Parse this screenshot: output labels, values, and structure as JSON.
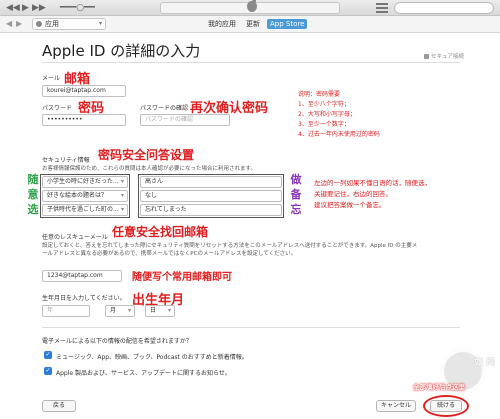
{
  "navbar": {
    "source_label": "应用",
    "tabs": [
      {
        "label": "我的应用",
        "active": false
      },
      {
        "label": "更新",
        "active": false
      },
      {
        "label": "App Store",
        "active": true
      }
    ]
  },
  "form": {
    "title": "Apple ID の詳細の入力",
    "secure_label": "セキュア接続",
    "email_label": "メール",
    "email_value": "kourei@taptap.com",
    "password_label": "パスワード",
    "password_value": "••••••••••",
    "password_confirm_label": "パスワードの確認",
    "password_confirm_placeholder": "パスワードの確認",
    "security_title": "セキュリティ情報",
    "security_desc": "お客様情報保護のため、これらの質問は本人確認が必要になった場合に利用されます。",
    "questions": [
      {
        "question": "小学生の時に好きだった...",
        "answer": "高さん"
      },
      {
        "question": "好きな絵本の題名は？",
        "answer": "なし"
      },
      {
        "question": "子供時代を過ごした町の...",
        "answer": "忘れてしまった"
      }
    ],
    "rescue_title": "任意のレスキューメール",
    "rescue_desc": "設定しておくと、答えを忘れてしまった際にセキュリティ質問をリセットする方法をこのメールアドレスへ送付することができます。Apple ID の主要メールアドレスと異なる必要があるので、携帯メールではなくPCのメールアドレスを設定してください。",
    "rescue_value": "1234@taptap.com",
    "birthday_label": "生年月日を入力してください。",
    "birthday_year_placeholder": "年",
    "birthday_month": "月",
    "birthday_day": "日",
    "mail_prompt": "電子メールによる以下の情報の配信を希望されますか？",
    "options": [
      {
        "label": "ミュージック、App、映画、ブック、Podcast のおすすめと新着情報。",
        "checked": true
      },
      {
        "label": "Apple 製品および、サービス、アップデートに関するお知らせ。",
        "checked": true
      }
    ],
    "back_label": "戻る",
    "cancel_label": "キャンセル",
    "continue_label": "続ける"
  },
  "annotations": {
    "email": "邮箱",
    "password": "密码",
    "confirm": "再次确认密码",
    "password_rules": [
      "说明：密码需要",
      "1、至少八个字符；",
      "2、大写和小写字母；",
      "3、至少一个数字；",
      "4、过去一年内未使用过的密码"
    ],
    "security": "密码安全问答设置",
    "random_left": [
      "随",
      "意",
      "选"
    ],
    "memo_right": [
      "做",
      "备",
      "忘"
    ],
    "security_note": [
      "左边的一列如果不懂日语的话，随便选，",
      "关键要记住，右边的回答。",
      "建议把答案做一个备忘。"
    ],
    "rescue": "任意安全找回邮箱",
    "rescue_note": "随便写个常用邮箱即可",
    "birthday": "出生年月",
    "continue_note": "全部填好后点这里"
  },
  "watermark": "如 网"
}
